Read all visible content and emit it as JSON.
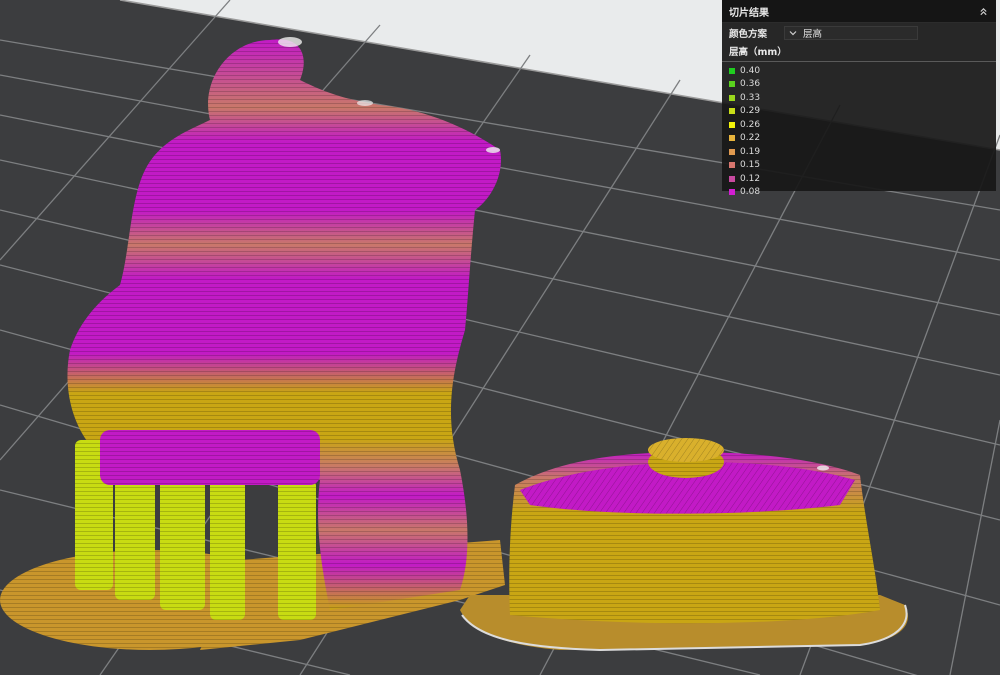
{
  "panel": {
    "title": "切片结果",
    "scheme_label": "颜色方案",
    "scheme_value": "层高",
    "legend_title": "层高（mm）",
    "legend": [
      {
        "value": "0.40",
        "color": "#1fcc1f"
      },
      {
        "value": "0.36",
        "color": "#5ad21e"
      },
      {
        "value": "0.33",
        "color": "#9ad81c"
      },
      {
        "value": "0.29",
        "color": "#c8de18"
      },
      {
        "value": "0.26",
        "color": "#f2f20a"
      },
      {
        "value": "0.22",
        "color": "#e8b43c"
      },
      {
        "value": "0.19",
        "color": "#e09a50"
      },
      {
        "value": "0.15",
        "color": "#d8766e"
      },
      {
        "value": "0.12",
        "color": "#c84aa0"
      },
      {
        "value": "0.08",
        "color": "#d21ed2"
      }
    ],
    "icons": {
      "collapse": "chevron-up-double-icon",
      "dropdown": "chevron-down-icon"
    }
  },
  "scene": {
    "bed_color": "#3c3d3f",
    "grid_color": "#8a8a8a",
    "colors": {
      "magenta": "#c21ac6",
      "gold": "#c9a614",
      "lime": "#c8dc12",
      "salmon": "#c9786a",
      "orange": "#d39c4a"
    }
  }
}
